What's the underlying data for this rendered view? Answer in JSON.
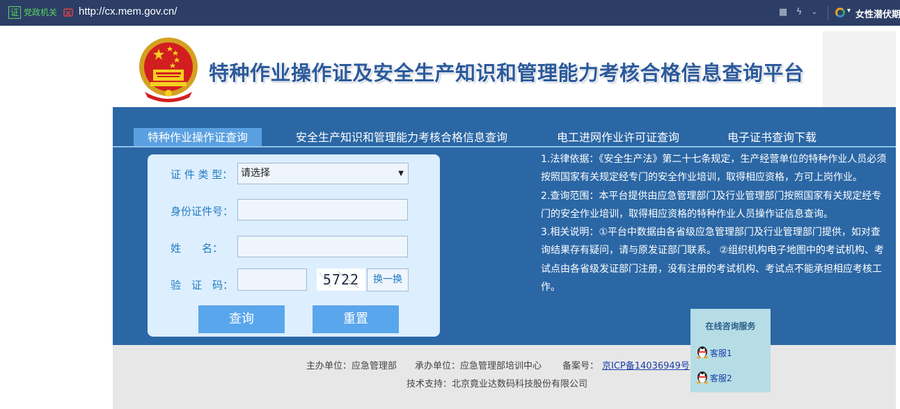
{
  "browser": {
    "cert_badge": "证",
    "cert_label": "党政机关",
    "url": "http://cx.mem.gov.cn/",
    "search_engine_text": "女性潜伏期",
    "icons": [
      "grid-icon",
      "lightning-icon",
      "chevron-down-icon"
    ]
  },
  "header": {
    "title": "特种作业操作证及安全生产知识和管理能力考核合格信息查询平台"
  },
  "tabs": [
    {
      "label": "特种作业操作证查询",
      "active": true
    },
    {
      "label": "安全生产知识和管理能力考核合格信息查询",
      "active": false
    },
    {
      "label": "电工进网作业许可证查询",
      "active": false
    },
    {
      "label": "电子证书查询下载",
      "active": false
    }
  ],
  "form": {
    "cert_type_label": "证 件 类 型：",
    "cert_type_value": "请选择",
    "id_label": "身份证件号：",
    "name_label": "姓　　名：",
    "captcha_label": "验　证　码：",
    "captcha_text": "5722",
    "refresh_label": "换一换",
    "query_label": "查询",
    "reset_label": "重置"
  },
  "info": {
    "p1": "1.法律依据：《安全生产法》第二十七条规定，生产经营单位的特种作业人员必须按照国家有关规定经专门的安全作业培训，取得相应资格，方可上岗作业。",
    "p2": "2.查询范围：本平台提供由应急管理部门及行业管理部门按照国家有关规定经专门的安全作业培训，取得相应资格的特种作业人员操作证信息查询。",
    "p3": "3.相关说明：①平台中数据由各省级应急管理部门及行业管理部门提供，如对查询结果存有疑问，请与原发证部门联系。 ②组织机构电子地图中的考试机构、考试点由各省级发证部门注册，没有注册的考试机构、考试点不能承担相应考核工作。"
  },
  "footer": {
    "host": "主办单位：应急管理部",
    "organizer": "承办单位：应急管理部培训中心",
    "icp_label": "备案号：",
    "icp_link": "京ICP备14036949号",
    "tech_support": "技术支持：北京竟业达数码科技股份有限公司"
  },
  "service": {
    "title": "在线咨询服务",
    "items": [
      {
        "label": "客服1"
      },
      {
        "label": "客服2"
      }
    ]
  },
  "colors": {
    "panel_blue": "#2b67a5",
    "active_tab": "#5aa0e0",
    "button_blue": "#5aa6ec",
    "title_blue": "#2c5a9a",
    "service_bg": "#b6dde5"
  }
}
